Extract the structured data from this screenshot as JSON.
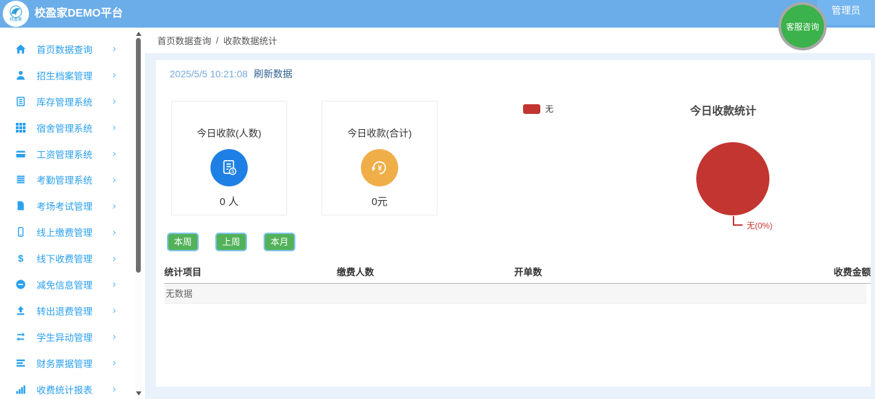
{
  "header": {
    "title": "校盈家DEMO平台",
    "logo_text": "校盈家",
    "user_label": "管理员",
    "service_badge": "客服咨询"
  },
  "sidebar": {
    "chevron": "›",
    "items": [
      {
        "label": "首页数据查询",
        "icon": "home-icon"
      },
      {
        "label": "招生档案管理",
        "icon": "user-icon"
      },
      {
        "label": "库存管理系统",
        "icon": "ledger-icon"
      },
      {
        "label": "宿舍管理系统",
        "icon": "grid-icon"
      },
      {
        "label": "工资管理系统",
        "icon": "wallet-icon"
      },
      {
        "label": "考勤管理系统",
        "icon": "list-book-icon"
      },
      {
        "label": "考场考试管理",
        "icon": "file-icon"
      },
      {
        "label": "线上缴费管理",
        "icon": "mobile-icon"
      },
      {
        "label": "线下收费管理",
        "icon": "dollar-icon"
      },
      {
        "label": "减免信息管理",
        "icon": "minus-circle-icon"
      },
      {
        "label": "转出退费管理",
        "icon": "upload-icon"
      },
      {
        "label": "学生异动管理",
        "icon": "exchange-icon"
      },
      {
        "label": "财务票据管理",
        "icon": "bars-icon"
      },
      {
        "label": "收费统计报表",
        "icon": "bar-chart-icon"
      }
    ]
  },
  "breadcrumb": {
    "parent": "首页数据查询",
    "separator": "/",
    "current": "收款数据统计"
  },
  "main": {
    "refresh_time": "2025/5/5 10:21:08",
    "refresh_label": "刷新数据",
    "stat_cards": [
      {
        "title": "今日收款(人数)",
        "value": "0 人",
        "icon": "bill-count-icon",
        "icon_color": "#1e80e5"
      },
      {
        "title": "今日收款(合计)",
        "value": "0元",
        "icon": "refund-yen-icon",
        "icon_color": "#efae47"
      }
    ],
    "filter_buttons": [
      "本周",
      "上周",
      "本月"
    ],
    "table": {
      "columns": [
        "统计项目",
        "缴费人数",
        "开单数",
        "收费金额"
      ],
      "empty_text": "无数据"
    }
  },
  "chart_data": {
    "type": "pie",
    "title": "今日收款统计",
    "legend": [
      "无"
    ],
    "legend_position": "top-left",
    "series": [
      {
        "name": "无",
        "value": 0,
        "percent": "0%",
        "label": "无(0%)",
        "color": "#c23531"
      }
    ]
  },
  "colors": {
    "header_bg": "#6aade9",
    "sidebar_accent": "#2aa0f0",
    "content_bg": "#e9f1fb",
    "button_green": "#53b259",
    "pie_red": "#c23531",
    "service_green": "#3bb24b"
  }
}
